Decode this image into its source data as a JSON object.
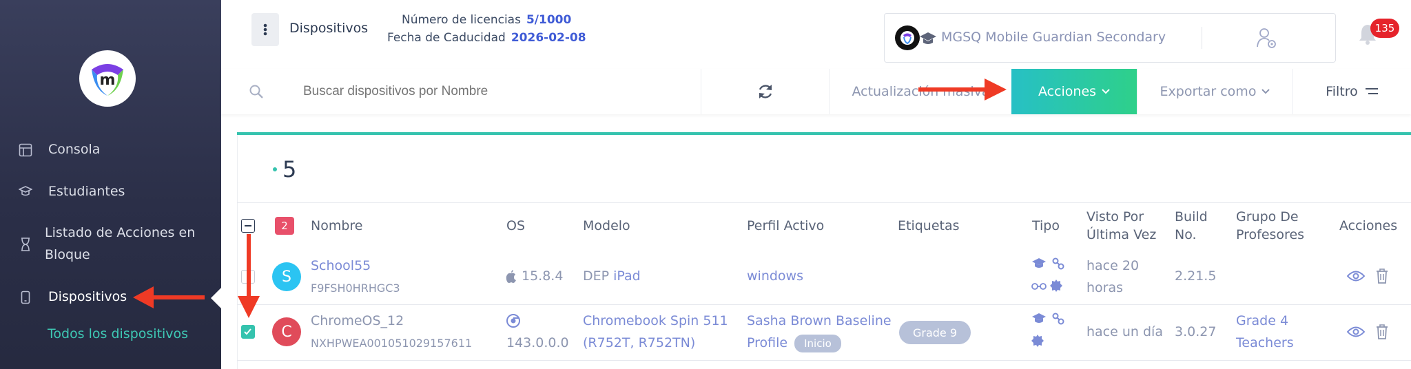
{
  "sidebar": {
    "items": [
      {
        "label": "Consola",
        "icon": "layout-icon"
      },
      {
        "label": "Estudiantes",
        "icon": "graduation-cap-icon"
      },
      {
        "label": "Listado de Acciones en",
        "label2": "Bloque",
        "icon": "hourglass-icon"
      },
      {
        "label": "Dispositivos",
        "icon": "mobile-device-icon"
      }
    ],
    "sub_item": "Todos los dispositivos"
  },
  "header": {
    "title": "Dispositivos",
    "license_label": "Número de licencias",
    "license_value": "5/1000",
    "expiry_label": "Fecha de Caducidad",
    "expiry_value": "2026-02-08",
    "org_name": "MGSQ Mobile Guardian Secondary",
    "notifications": "135"
  },
  "toolbar": {
    "search_placeholder": "Buscar dispositivos por Nombre",
    "bulk_update": "Actualización masiva",
    "actions": "Acciones",
    "export": "Exportar como",
    "filter": "Filtro"
  },
  "table": {
    "count": "5",
    "selected": "2",
    "headers": {
      "name": "Nombre",
      "os": "OS",
      "model": "Modelo",
      "profile": "Perfil Activo",
      "tags": "Etiquetas",
      "type": "Tipo",
      "seen_1": "Visto Por",
      "seen_2": "Última Vez",
      "build_1": "Build",
      "build_2": "No.",
      "group_1": "Grupo De",
      "group_2": "Profesores",
      "actions": "Acciones"
    },
    "rows": [
      {
        "initial": "S",
        "avatar_color": "#2bc4f2",
        "name": "School55",
        "serial": "F9FSH0HRHGC3",
        "os": "15.8.4",
        "model_prefix": "DEP",
        "model": "iPad",
        "profile": "windows",
        "seen_1": "hace 20",
        "seen_2": "horas",
        "build": "2.21.5",
        "group_1": "",
        "group_2": "",
        "checked": false
      },
      {
        "initial": "C",
        "avatar_color": "#e04b5a",
        "name": "ChromeOS_12",
        "serial": "NXHPWEA001051029157611",
        "os": "143.0.0.0",
        "model_1": "Chromebook Spin 511",
        "model_2": "(R752T, R752TN)",
        "profile_1": "Sasha Brown Baseline",
        "profile_2": "Profile",
        "profile_badge": "Inicio",
        "tag": "Grade 9",
        "seen": "hace un día",
        "build": "3.0.27",
        "group_1": "Grade 4",
        "group_2": "Teachers",
        "checked": true
      }
    ]
  },
  "colors": {
    "accent": "#35c3ae",
    "link": "#3f5bd6",
    "arrow": "#ef3a25"
  }
}
